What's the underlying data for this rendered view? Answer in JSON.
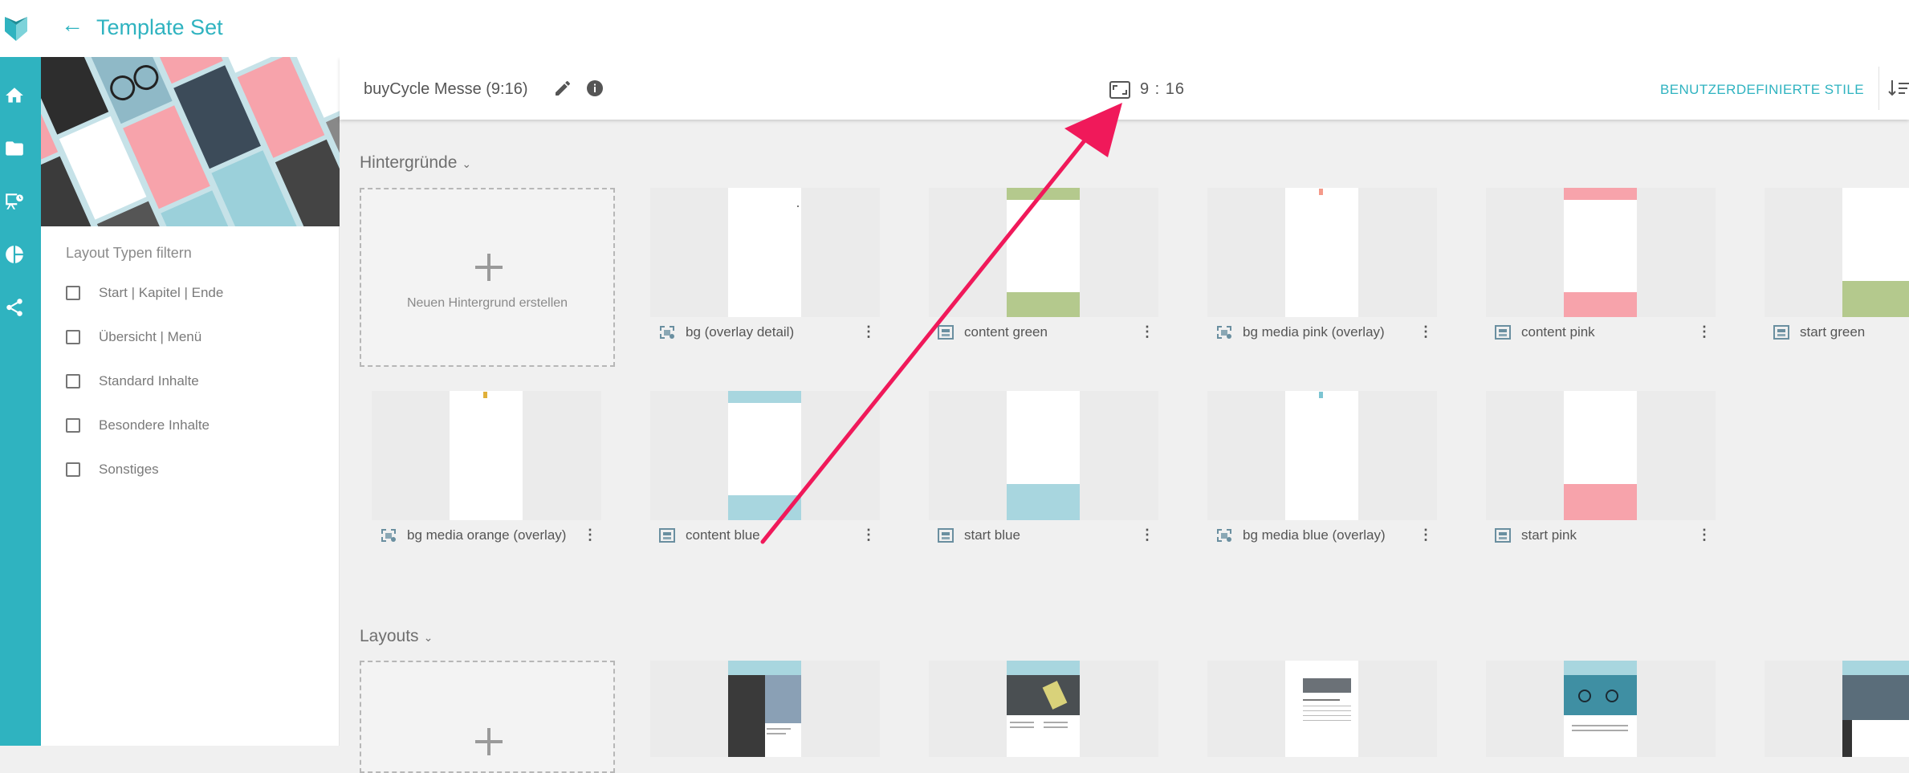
{
  "app": {
    "title": "Template Set"
  },
  "rail": {
    "icons": [
      "home-icon",
      "folder-icon",
      "presentation-icon",
      "pie-chart-icon",
      "share-icon"
    ]
  },
  "colors": {
    "accent": "#2fb3c0",
    "arrow": "#f0195a",
    "pink": "#f7a3ab",
    "green": "#b4c98d",
    "blue": "#a8d6df"
  },
  "filter": {
    "title": "Layout Typen filtern",
    "items": [
      {
        "label": "Start | Kapitel | Ende",
        "checked": false
      },
      {
        "label": "Übersicht | Menü",
        "checked": false
      },
      {
        "label": "Standard Inhalte",
        "checked": false
      },
      {
        "label": "Besondere Inhalte",
        "checked": false
      },
      {
        "label": "Sonstiges",
        "checked": false
      }
    ]
  },
  "header": {
    "set_name": "buyCycle Messe (9:16)",
    "ratio": "9 : 16",
    "custom_styles": "BENUTZERDEFINIERTE STILE"
  },
  "backgrounds": {
    "label": "Hintergründe",
    "new_label": "Neuen Hintergrund erstellen",
    "items": [
      {
        "label": "bg (overlay detail)",
        "variant": "plain",
        "icon": "overlay-icon"
      },
      {
        "label": "content green",
        "variant": "green-top-bottom",
        "icon": "layout-icon"
      },
      {
        "label": "bg media pink (overlay)",
        "variant": "pink-dot",
        "icon": "overlay-icon"
      },
      {
        "label": "content pink",
        "variant": "pink-top-bottom",
        "icon": "layout-icon"
      },
      {
        "label": "start green",
        "variant": "green-bottom",
        "icon": "layout-icon"
      },
      {
        "label": "bg media orange (overlay)",
        "variant": "orange-dot",
        "icon": "overlay-icon"
      },
      {
        "label": "content blue",
        "variant": "blue-top-bottom",
        "icon": "layout-icon"
      },
      {
        "label": "start blue",
        "variant": "blue-bottom",
        "icon": "layout-icon"
      },
      {
        "label": "bg media blue (overlay)",
        "variant": "blue-dot",
        "icon": "overlay-icon"
      },
      {
        "label": "start pink",
        "variant": "pink-bottom",
        "icon": "layout-icon"
      }
    ]
  },
  "layouts": {
    "label": "Layouts"
  }
}
